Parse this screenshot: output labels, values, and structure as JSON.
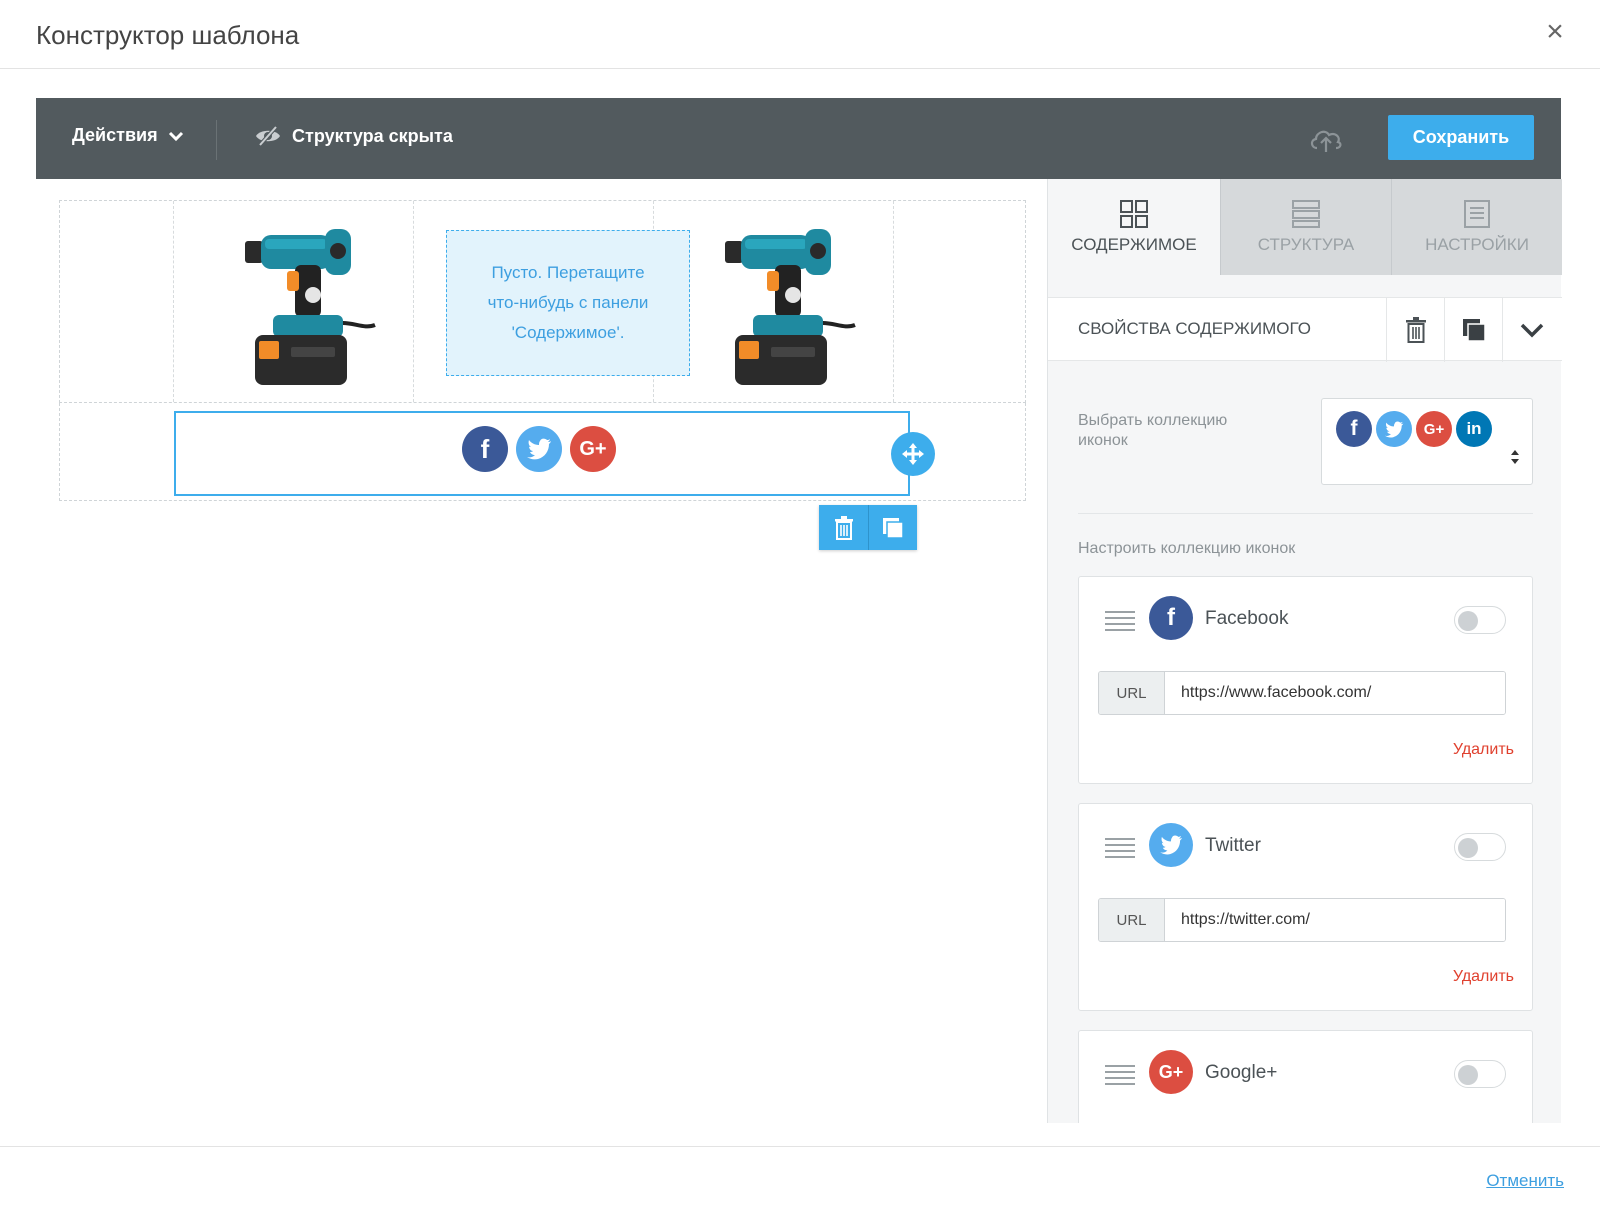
{
  "modal": {
    "title": "Конструктор шаблона",
    "close_label": "×",
    "cancel_label": "Отменить"
  },
  "toolbar": {
    "actions_label": "Действия",
    "structure_label": "Структура скрыта",
    "save_label": "Сохранить"
  },
  "canvas": {
    "empty_slot_lines": [
      "Пусто. Перетащите",
      "что-нибудь с панели",
      "'Содержимое'."
    ],
    "social_block_icons": [
      "facebook-icon",
      "twitter-icon",
      "google-plus-icon"
    ]
  },
  "panel": {
    "tabs": [
      {
        "label": "СОДЕРЖИМОЕ",
        "icon": "grid-icon",
        "active": true
      },
      {
        "label": "СТРУКТУРА",
        "icon": "rows-icon",
        "active": false
      },
      {
        "label": "НАСТРОЙКИ",
        "icon": "settings-doc-icon",
        "active": false
      }
    ],
    "props_title": "СВОЙСТВА СОДЕРЖИМОГО",
    "pick_collection_label": "Выбрать коллекцию иконок",
    "configure_collection_label": "Настроить коллекцию иконок",
    "items": [
      {
        "name": "Facebook",
        "url_label": "URL",
        "url": "https://www.facebook.com/",
        "delete_label": "Удалить"
      },
      {
        "name": "Twitter",
        "url_label": "URL",
        "url": "https://twitter.com/",
        "delete_label": "Удалить"
      },
      {
        "name": "Google+"
      }
    ]
  },
  "colors": {
    "accent": "#3dadec",
    "toolbar_bg": "#525a5e",
    "facebook": "#3b5998",
    "twitter": "#55acee",
    "google_plus": "#dc4e41",
    "linkedin": "#0077b5",
    "delete": "#e0402e"
  }
}
